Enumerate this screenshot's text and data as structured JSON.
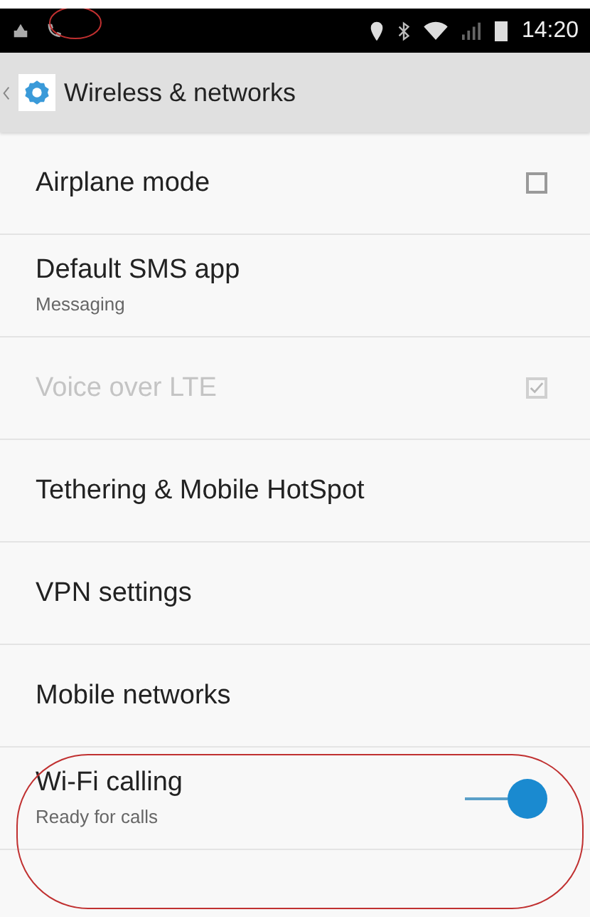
{
  "status_bar": {
    "time": "14:20"
  },
  "header": {
    "title": "Wireless & networks"
  },
  "settings": [
    {
      "kind": "checkbox",
      "title": "Airplane mode",
      "checked": false,
      "disabled": false
    },
    {
      "kind": "plain",
      "title": "Default SMS app",
      "subtitle": "Messaging",
      "disabled": false
    },
    {
      "kind": "checkbox",
      "title": "Voice over LTE",
      "checked": true,
      "disabled": true
    },
    {
      "kind": "plain",
      "title": "Tethering & Mobile HotSpot",
      "disabled": false
    },
    {
      "kind": "plain",
      "title": "VPN settings",
      "disabled": false
    },
    {
      "kind": "plain",
      "title": "Mobile networks",
      "disabled": false
    },
    {
      "kind": "switch",
      "title": "Wi-Fi calling",
      "subtitle": "Ready for calls",
      "on": true,
      "disabled": false
    }
  ]
}
